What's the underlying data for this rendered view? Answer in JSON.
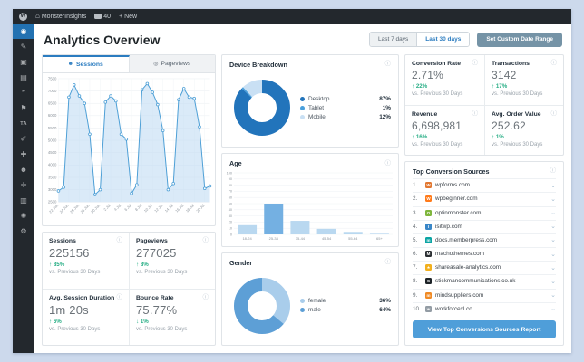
{
  "admin_bar": {
    "wp_logo": "W",
    "site_name": "MonsterInsights",
    "comment_count": "40",
    "new_label": "+ New"
  },
  "sidebar": {
    "items": [
      {
        "name": "dashboard",
        "glyph": "◉",
        "active": true
      },
      {
        "name": "posts",
        "glyph": "✎",
        "active": false
      },
      {
        "name": "media",
        "glyph": "▣",
        "active": false
      },
      {
        "name": "pages",
        "glyph": "▤",
        "active": false
      },
      {
        "name": "comments",
        "glyph": "❞",
        "active": false
      },
      {
        "name": "feedback",
        "glyph": "⚑",
        "active": false
      },
      {
        "name": "ta-plugin",
        "glyph": "TA",
        "active": false,
        "text_icon": true
      },
      {
        "name": "appearance",
        "glyph": "✐",
        "active": false
      },
      {
        "name": "plugins",
        "glyph": "✚",
        "active": false
      },
      {
        "name": "users",
        "glyph": "☻",
        "active": false
      },
      {
        "name": "tools",
        "glyph": "✛",
        "active": false
      },
      {
        "name": "settings",
        "glyph": "▥",
        "active": false
      },
      {
        "name": "insights",
        "glyph": "✺",
        "active": false
      },
      {
        "name": "collapse",
        "glyph": "⚙",
        "active": false
      }
    ]
  },
  "header": {
    "title": "Analytics Overview",
    "range_buttons": [
      {
        "label": "Last 7 days",
        "active": false
      },
      {
        "label": "Last 30 days",
        "active": true
      }
    ],
    "custom_range_label": "Set Custom Date Range"
  },
  "tabs": [
    {
      "label": "Sessions",
      "active": true,
      "icon": "user-icon"
    },
    {
      "label": "Pageviews",
      "active": false,
      "icon": "eye-icon"
    }
  ],
  "chart_data": [
    {
      "type": "line",
      "name": "sessions-over-time",
      "x": [
        "22 Jun",
        "23 Jun",
        "24 Jun",
        "25 Jun",
        "26 Jun",
        "27 Jun",
        "28 Jun",
        "29 Jun",
        "30 Jun",
        "1 Jul",
        "2 Jul",
        "3 Jul",
        "4 Jul",
        "5 Jul",
        "6 Jul",
        "7 Jul",
        "8 Jul",
        "9 Jul",
        "10 Jul",
        "11 Jul",
        "12 Jul",
        "13 Jul",
        "14 Jul",
        "15 Jul",
        "16 Jul",
        "17 Jul",
        "18 Jul",
        "19 Jul",
        "20 Jul",
        "21 Jul"
      ],
      "values": [
        2950,
        3100,
        6750,
        7250,
        6800,
        6500,
        5250,
        2800,
        3000,
        6550,
        6800,
        6600,
        5250,
        5050,
        2850,
        3200,
        7050,
        7300,
        6950,
        6450,
        5400,
        3000,
        3250,
        6650,
        7100,
        6750,
        6700,
        5550,
        3050,
        3150
      ],
      "x_tick_labels": [
        "22 Jun",
        "24 Jun",
        "26 Jun",
        "28 Jun",
        "30 Jun",
        "2 Jul",
        "4 Jul",
        "6 Jul",
        "8 Jul",
        "10 Jul",
        "12 Jul",
        "14 Jul",
        "16 Jul",
        "18 Jul",
        "20 Jul"
      ],
      "x_tick_every": 2,
      "ylim": [
        2500,
        7500
      ],
      "yticks": [
        2500,
        3000,
        3500,
        4000,
        4500,
        5000,
        5500,
        6000,
        6500,
        7000,
        7500
      ],
      "line_color": "#4d9fd6",
      "fill_color": "rgba(187,216,242,0.55)",
      "grid": true
    },
    {
      "type": "pie",
      "name": "device-breakdown",
      "title": "Device Breakdown",
      "labels": [
        "Desktop",
        "Tablet",
        "Mobile"
      ],
      "values": [
        87,
        1,
        12
      ],
      "display_values": [
        "87%",
        "1%",
        "12%"
      ],
      "colors": [
        "#2274bb",
        "#4aa0dc",
        "#c9e0f4"
      ],
      "legend_position": "right"
    },
    {
      "type": "bar",
      "name": "age",
      "title": "Age",
      "categories": [
        "18-24",
        "25-34",
        "35-44",
        "45-54",
        "55-64",
        "65+"
      ],
      "values": [
        15,
        50,
        22,
        9,
        4,
        1
      ],
      "ylim": [
        0,
        100
      ],
      "yticks": [
        0,
        10,
        20,
        30,
        40,
        50,
        60,
        70,
        80,
        90,
        100
      ],
      "bar_color": "#b9d8f0",
      "highlight_index": 1,
      "highlight_color": "#74b0e2",
      "grid": true
    },
    {
      "type": "pie",
      "name": "gender",
      "title": "Gender",
      "labels": [
        "female",
        "male"
      ],
      "values": [
        36,
        64
      ],
      "display_values": [
        "36%",
        "64%"
      ],
      "colors": [
        "#a9cdeb",
        "#5d9fd6"
      ],
      "legend_position": "right"
    }
  ],
  "stats_left": [
    {
      "title": "Sessions",
      "value": "225156",
      "direction": "up",
      "change": "85%",
      "caption": "vs. Previous 30 Days"
    },
    {
      "title": "Pageviews",
      "value": "277025",
      "direction": "up",
      "change": "8%",
      "caption": "vs. Previous 30 Days"
    },
    {
      "title": "Avg. Session Duration",
      "value": "1m 20s",
      "direction": "up",
      "change": "6%",
      "caption": "vs. Previous 30 Days"
    },
    {
      "title": "Bounce Rate",
      "value": "75.77%",
      "direction": "down",
      "change": "1%",
      "caption": "vs. Previous 30 Days"
    }
  ],
  "stats_right": [
    {
      "title": "Conversion Rate",
      "value": "2.71%",
      "direction": "up",
      "change": "22%",
      "caption": "vs. Previous 30 Days"
    },
    {
      "title": "Transactions",
      "value": "3142",
      "direction": "up",
      "change": "17%",
      "caption": "vs. Previous 30 Days"
    },
    {
      "title": "Revenue",
      "value": "6,698,981",
      "direction": "up",
      "change": "16%",
      "caption": "vs. Previous 30 Days"
    },
    {
      "title": "Avg. Order Value",
      "value": "252.62",
      "direction": "up",
      "change": "1%",
      "caption": "vs. Previous 30 Days"
    }
  ],
  "sources": {
    "title": "Top Conversion Sources",
    "items": [
      {
        "rank": "1.",
        "domain": "wpforms.com",
        "favicon_color": "#e27730",
        "favicon_letter": "W"
      },
      {
        "rank": "2.",
        "domain": "wpbeginner.com",
        "favicon_color": "#ff7a1a",
        "favicon_letter": "W"
      },
      {
        "rank": "3.",
        "domain": "optinmonster.com",
        "favicon_color": "#7fb63d",
        "favicon_letter": "O"
      },
      {
        "rank": "4.",
        "domain": "isitwp.com",
        "favicon_color": "#3a87c8",
        "favicon_letter": "I"
      },
      {
        "rank": "5.",
        "domain": "docs.memberpress.com",
        "favicon_color": "#0ba4a4",
        "favicon_letter": "m"
      },
      {
        "rank": "6.",
        "domain": "machothemes.com",
        "favicon_color": "#2b2f33",
        "favicon_letter": "M"
      },
      {
        "rank": "7.",
        "domain": "shareasale-analytics.com",
        "favicon_color": "#f2b01e",
        "favicon_letter": "★"
      },
      {
        "rank": "8.",
        "domain": "stickmancommunications.co.uk",
        "favicon_color": "#1d2327",
        "favicon_letter": "S"
      },
      {
        "rank": "9.",
        "domain": "mindsuppliers.com",
        "favicon_color": "#f08a24",
        "favicon_letter": "m"
      },
      {
        "rank": "10.",
        "domain": "workforcexl.co",
        "favicon_color": "#939ca4",
        "favicon_letter": "w"
      }
    ],
    "report_button_label": "View Top Conversions Sources Report"
  },
  "ui": {
    "accent_blue": "#4f9ed9",
    "green": "#27ae85",
    "info_icon": "ⓘ",
    "up_arrow": "↑",
    "down_arrow": "↓",
    "chevron": "⌄"
  }
}
